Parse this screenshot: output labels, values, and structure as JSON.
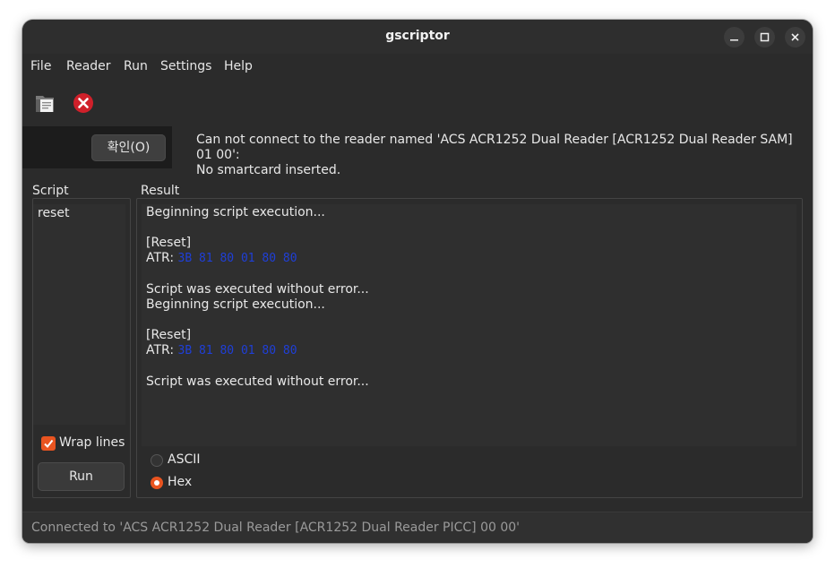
{
  "window": {
    "title": "gscriptor"
  },
  "menu": [
    "File",
    "Reader",
    "Run",
    "Settings",
    "Help"
  ],
  "toolbar": {
    "open_icon": "folder-document-icon",
    "stop_icon": "close-circle-icon"
  },
  "infobar": {
    "ok_label": "확인(O)",
    "message_line1": "Can not connect to the reader named 'ACS ACR1252 Dual Reader [ACR1252 Dual Reader SAM] 01 00':",
    "message_line2": "No smartcard inserted."
  },
  "script_panel": {
    "label": "Script",
    "content": "reset",
    "wrap_lines_label": "Wrap lines",
    "wrap_lines_checked": true,
    "run_label": "Run"
  },
  "result_panel": {
    "label": "Result",
    "lines": [
      {
        "text": "Beginning script execution..."
      },
      {
        "text": ""
      },
      {
        "text": "[Reset]"
      },
      {
        "text": "ATR: ",
        "hex": "3B 81 80 01 80 80"
      },
      {
        "text": ""
      },
      {
        "text": "Script was executed without error..."
      },
      {
        "text": "Beginning script execution..."
      },
      {
        "text": ""
      },
      {
        "text": "[Reset]"
      },
      {
        "text": "ATR: ",
        "hex": "3B 81 80 01 80 80"
      },
      {
        "text": ""
      },
      {
        "text": "Script was executed without error..."
      }
    ],
    "ascii_label": "ASCII",
    "hex_label": "Hex",
    "selected": "Hex"
  },
  "status": {
    "text": "Connected to 'ACS ACR1252 Dual Reader [ACR1252 Dual Reader PICC] 00 00'"
  },
  "colors": {
    "accent": "#e95420",
    "hex_text": "#1f3fd8"
  }
}
